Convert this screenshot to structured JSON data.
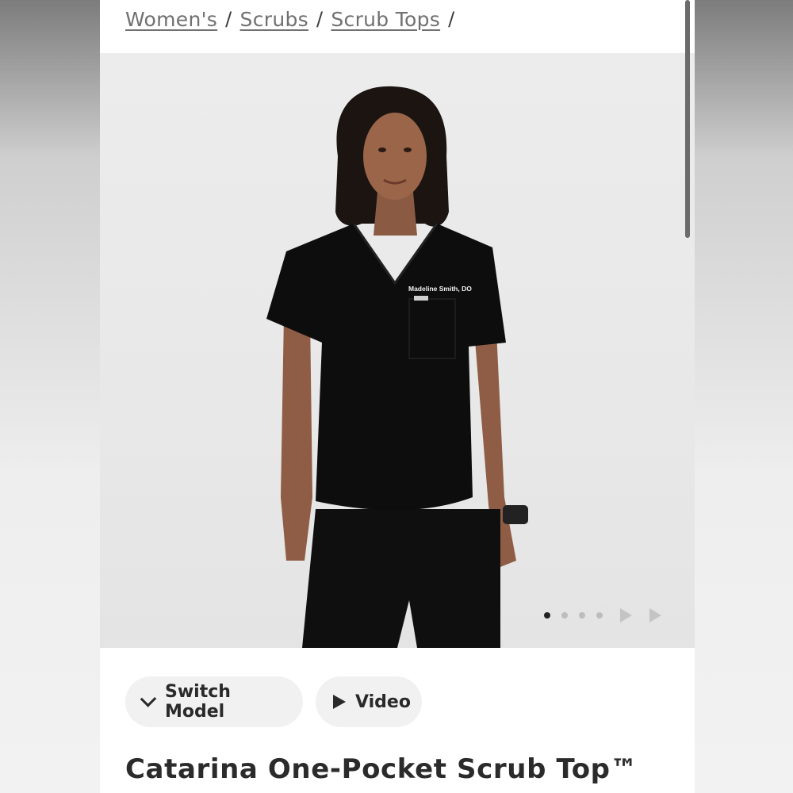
{
  "breadcrumb": {
    "items": [
      "Women's",
      "Scrubs",
      "Scrub Tops"
    ],
    "separator": "/"
  },
  "product_image": {
    "embroidery": "Madeline Smith, DO",
    "carousel": {
      "total_dots": 4,
      "active_index": 0
    }
  },
  "actions": {
    "switch_model_label": "Switch Model",
    "video_label": "Video"
  },
  "product": {
    "title": "Catarina One-Pocket Scrub Top™"
  },
  "icons": {
    "switch_model": "chevron-down-icon",
    "video": "play-icon",
    "next": "next-arrow-icon"
  },
  "colors": {
    "scrub": "#0d0d0d",
    "hero_bg": "#e8e8e8",
    "pill_bg": "#f1f1f1",
    "link": "#707070"
  }
}
